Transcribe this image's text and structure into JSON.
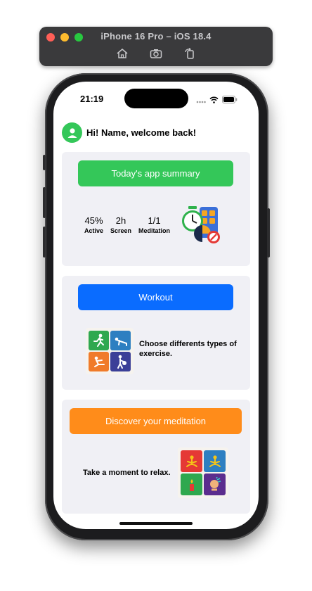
{
  "simulator": {
    "title": "iPhone 16 Pro – iOS 18.4",
    "tools": [
      "home-icon",
      "screenshot-icon",
      "rotate-icon"
    ]
  },
  "status_bar": {
    "time": "21:19"
  },
  "header": {
    "greeting": "Hi! Name, welcome back!"
  },
  "summary_card": {
    "button_label": "Today's app summary",
    "stats": [
      {
        "value": "45%",
        "label": "Active"
      },
      {
        "value": "2h",
        "label": "Screen"
      },
      {
        "value": "1/1",
        "label": "Meditation"
      }
    ]
  },
  "workout_card": {
    "button_label": "Workout",
    "description": "Choose differents types of exercise."
  },
  "meditation_card": {
    "button_label": "Discover your meditation",
    "description": "Take a moment to relax."
  },
  "colors": {
    "green": "#34c759",
    "blue": "#0a6cff",
    "orange": "#ff8c1a",
    "card_bg": "#f0f0f5"
  }
}
